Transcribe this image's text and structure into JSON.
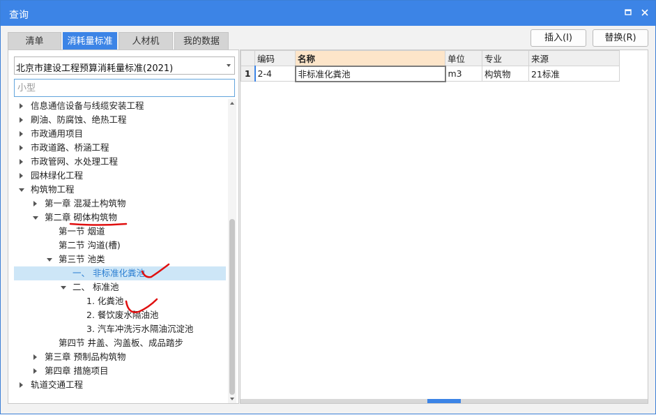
{
  "window": {
    "title": "查询",
    "accent_color": "#3c84e6",
    "controls": {
      "maximize_icon": "maximize-icon",
      "close_icon": "close-icon"
    }
  },
  "tabs": [
    {
      "label": "清单",
      "active": false
    },
    {
      "label": "消耗量标准",
      "active": true
    },
    {
      "label": "人材机",
      "active": false
    },
    {
      "label": "我的数据",
      "active": false
    }
  ],
  "actions": {
    "insert_label": "插入(I)",
    "replace_label": "替换(R)"
  },
  "left": {
    "standard_select": "北京市建设工程预算消耗量标准(2021)",
    "search_placeholder": "小型",
    "tree": [
      {
        "label": "信息通信设备与线缆安装工程",
        "level": 0,
        "state": "collapsed"
      },
      {
        "label": "刷油、防腐蚀、绝热工程",
        "level": 0,
        "state": "collapsed"
      },
      {
        "label": "市政通用项目",
        "level": 0,
        "state": "collapsed"
      },
      {
        "label": "市政道路、桥涵工程",
        "level": 0,
        "state": "collapsed"
      },
      {
        "label": "市政管网、水处理工程",
        "level": 0,
        "state": "collapsed"
      },
      {
        "label": "园林绿化工程",
        "level": 0,
        "state": "collapsed"
      },
      {
        "label": "构筑物工程",
        "level": 0,
        "state": "expanded"
      },
      {
        "label": "第一章 混凝土构筑物",
        "level": 1,
        "state": "collapsed"
      },
      {
        "label": "第二章 砌体构筑物",
        "level": 1,
        "state": "expanded"
      },
      {
        "label": "第一节 烟道",
        "level": 2,
        "state": "leaf"
      },
      {
        "label": "第二节 沟道(槽)",
        "level": 2,
        "state": "leaf"
      },
      {
        "label": "第三节 池类",
        "level": 2,
        "state": "expanded"
      },
      {
        "label": "一、 非标准化粪池",
        "level": 3,
        "state": "leaf",
        "selected": true
      },
      {
        "label": "二、 标准池",
        "level": 3,
        "state": "expanded"
      },
      {
        "label": "1. 化粪池",
        "level": 4,
        "state": "leaf"
      },
      {
        "label": "2. 餐饮废水隔油池",
        "level": 4,
        "state": "leaf"
      },
      {
        "label": "3. 汽车冲洗污水隔油沉淀池",
        "level": 4,
        "state": "leaf"
      },
      {
        "label": "第四节 井盖、沟盖板、成品踏步",
        "level": 2,
        "state": "leaf"
      },
      {
        "label": "第三章 预制品构筑物",
        "level": 1,
        "state": "collapsed"
      },
      {
        "label": "第四章 措施项目",
        "level": 1,
        "state": "collapsed"
      },
      {
        "label": "轨道交通工程",
        "level": 0,
        "state": "collapsed"
      }
    ]
  },
  "grid": {
    "columns": [
      "",
      "编码",
      "名称",
      "单位",
      "专业",
      "来源"
    ],
    "rows": [
      {
        "num": "1",
        "code": "2-4",
        "name": "非标准化粪池",
        "unit": "m3",
        "major": "构筑物",
        "source": "21标准"
      }
    ]
  }
}
